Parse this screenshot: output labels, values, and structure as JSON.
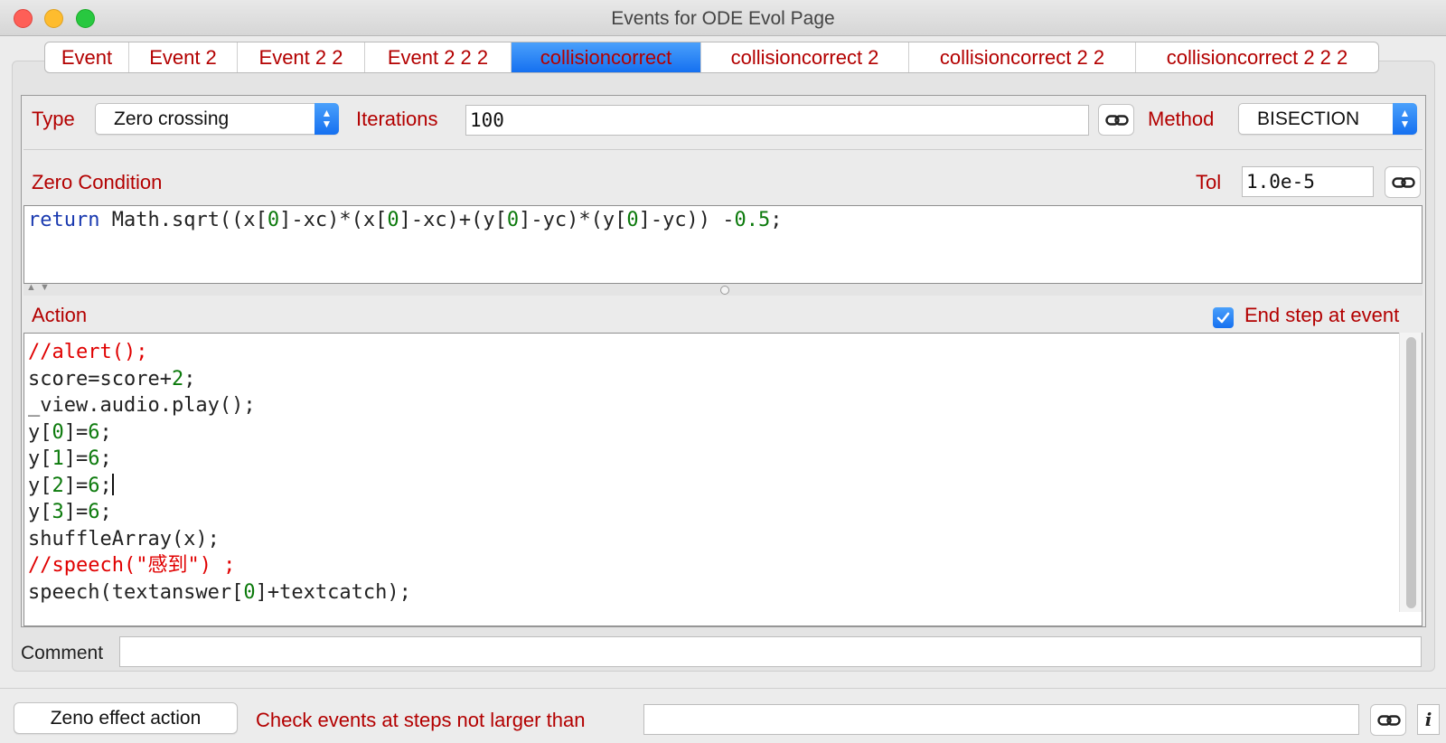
{
  "window": {
    "title": "Events for ODE Evol Page"
  },
  "tabs": [
    {
      "label": "Event",
      "active": false
    },
    {
      "label": "Event 2",
      "active": false
    },
    {
      "label": "Event 2 2",
      "active": false
    },
    {
      "label": "Event 2 2 2",
      "active": false
    },
    {
      "label": "collisioncorrect",
      "active": true
    },
    {
      "label": "collisioncorrect 2",
      "active": false
    },
    {
      "label": "collisioncorrect 2 2",
      "active": false
    },
    {
      "label": "collisioncorrect 2 2 2",
      "active": false
    }
  ],
  "settings": {
    "type_label": "Type",
    "type_value": "Zero crossing",
    "iterations_label": "Iterations",
    "iterations_value": "100",
    "method_label": "Method",
    "method_value": "BISECTION"
  },
  "zero_condition": {
    "label": "Zero Condition",
    "tol_label": "Tol",
    "tol_value": "1.0e-5",
    "code": "return Math.sqrt((x[0]-xc)*(x[0]-xc)+(y[0]-yc)*(y[0]-yc)) -0.5;"
  },
  "action": {
    "label": "Action",
    "end_step_label": "End step at event",
    "end_step_checked": true,
    "code_lines": [
      "//alert();",
      "score=score+2;",
      "_view.audio.play();",
      "y[0]=6;",
      "y[1]=6;",
      "y[2]=6;",
      "y[3]=6;",
      "shuffleArray(x);",
      "//speech(\"感到\") ;",
      "speech(textanswer[0]+textcatch);"
    ]
  },
  "comment": {
    "label": "Comment",
    "value": ""
  },
  "bottom": {
    "zeno_button": "Zeno effect action",
    "check_label": "Check events at steps not larger than",
    "check_value": "",
    "info_label": "i"
  },
  "icons": {
    "link": "link-icon",
    "info": "info-icon",
    "check": "checkmark-icon",
    "updown": "updown-arrows-icon"
  },
  "colors": {
    "label_red": "#b30000",
    "accent_blue": "#1570f0",
    "keyword": "#1a3ab0",
    "number": "#0c7a0c",
    "comment": "#e00000"
  }
}
